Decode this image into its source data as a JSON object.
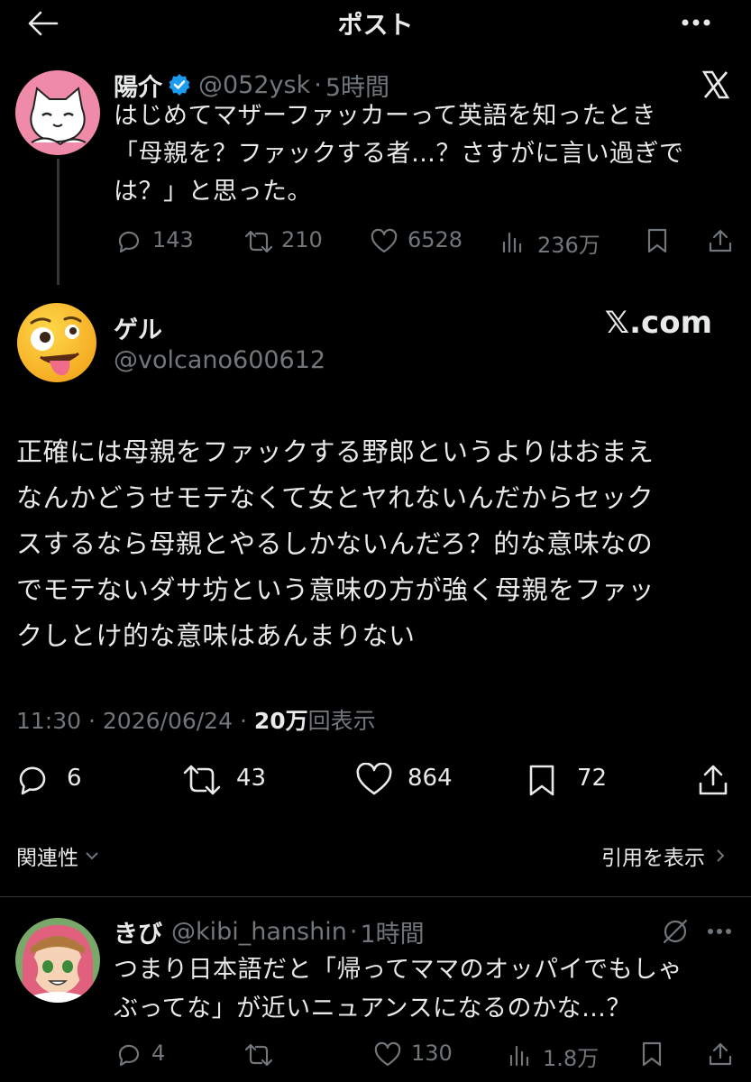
{
  "header": {
    "title": "ポスト"
  },
  "quoted_post": {
    "name": "陽介",
    "handle": "@052ysk",
    "time": "5時間",
    "lines": [
      "はじめてマザーファッカーって英語を知ったとき",
      "「母親を？ファックする者…？さすがに言い過ぎで",
      "は？」と思った。"
    ],
    "replies": "143",
    "reposts": "210",
    "likes": "6528",
    "views": "236万"
  },
  "main_post": {
    "name": "ゲル",
    "handle": "@volcano600612",
    "watermark": "𝕏.com",
    "lines": [
      "正確には母親をファックする野郎というよりはおまえ",
      "なんかどうせモテなくて女とヤれないんだからセック",
      "スするなら母親とやるしかないんだろ？的な意味なの",
      "でモテないダサ坊という意味の方が強く母親をファッ",
      "クしとけ的な意味はあんまりない"
    ],
    "time": "11:30",
    "date": "2026/06/24",
    "views_count": "20万",
    "views_label": "回表示",
    "replies": "6",
    "reposts": "43",
    "likes": "864",
    "bookmarks": "72"
  },
  "related": {
    "label": "関連性",
    "quotes_link": "引用を表示"
  },
  "reply_post": {
    "name": "きび",
    "handle": "@kibi_hanshin",
    "time": "1時間",
    "lines": [
      "つまり日本語だと「帰ってママのオッパイでもしゃ",
      "ぶってな」が近いニュアンスになるのかな…？"
    ],
    "replies": "4",
    "likes": "130",
    "views": "1.8万"
  },
  "colors": {
    "background": "#000000",
    "text": "#e7e9ea",
    "muted": "#71767b",
    "verified": "#1d9bf0",
    "divider": "#2f3336"
  }
}
